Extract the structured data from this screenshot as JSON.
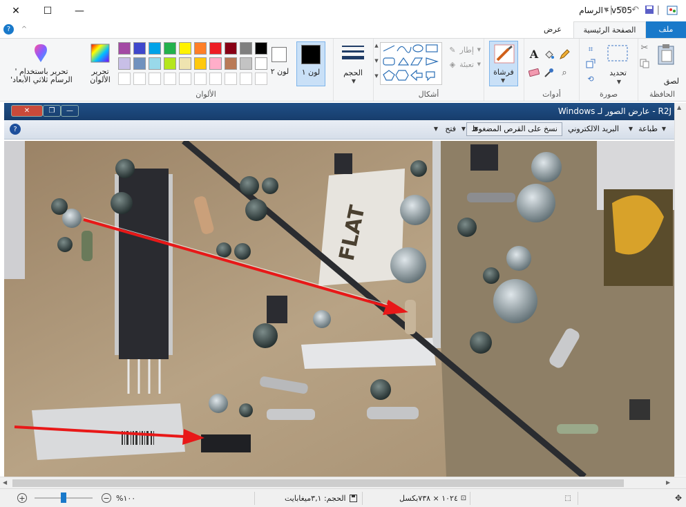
{
  "window": {
    "title": "v505 - الرسام",
    "minimize_glyph": "—",
    "maximize_glyph": "☐",
    "close_glyph": "✕"
  },
  "tabs": {
    "file": "ملف",
    "home": "الصفحة الرئيسية",
    "view": "عرض"
  },
  "ribbon": {
    "clipboard": {
      "label": "الحافظة",
      "paste": "لصق"
    },
    "image": {
      "label": "صورة",
      "select": "تحديد"
    },
    "tools": {
      "label": "أدوات"
    },
    "brushes": {
      "label": "فرشاة"
    },
    "shapes": {
      "label": "أشكال",
      "outline": "إطار",
      "fill": "تعبئة"
    },
    "size": {
      "label": "الحجم"
    },
    "color1": {
      "label": "لون ١"
    },
    "color2": {
      "label": "لون ٢"
    },
    "colors": {
      "label": "الألوان",
      "edit": "تحرير الألوان"
    },
    "paint3d": {
      "label": "تحرير باستخدام ' الرسام ثلاثي الأبعاد'"
    },
    "palette": [
      "#000000",
      "#7f7f7f",
      "#880015",
      "#ed1c24",
      "#ff7f27",
      "#fff200",
      "#22b14c",
      "#00a2e8",
      "#3f48cc",
      "#a349a4",
      "#ffffff",
      "#c3c3c3",
      "#b97a57",
      "#ffaec9",
      "#ffc90e",
      "#efe4b0",
      "#b5e61d",
      "#99d9ea",
      "#7092be",
      "#c8bfe7"
    ]
  },
  "viewer": {
    "title": "R2J - عارض الصور لـ Windows",
    "print": "طباعة",
    "email": "البريد الالكتروني",
    "burn": "نسخ على القرص المضغوط",
    "open": "فتح"
  },
  "status": {
    "zoom": "١٠٠%",
    "size": "الحجم: ٣,١ميغابايت",
    "dimensions": "١٠٢٤ × ٧٣٨بكسل"
  }
}
